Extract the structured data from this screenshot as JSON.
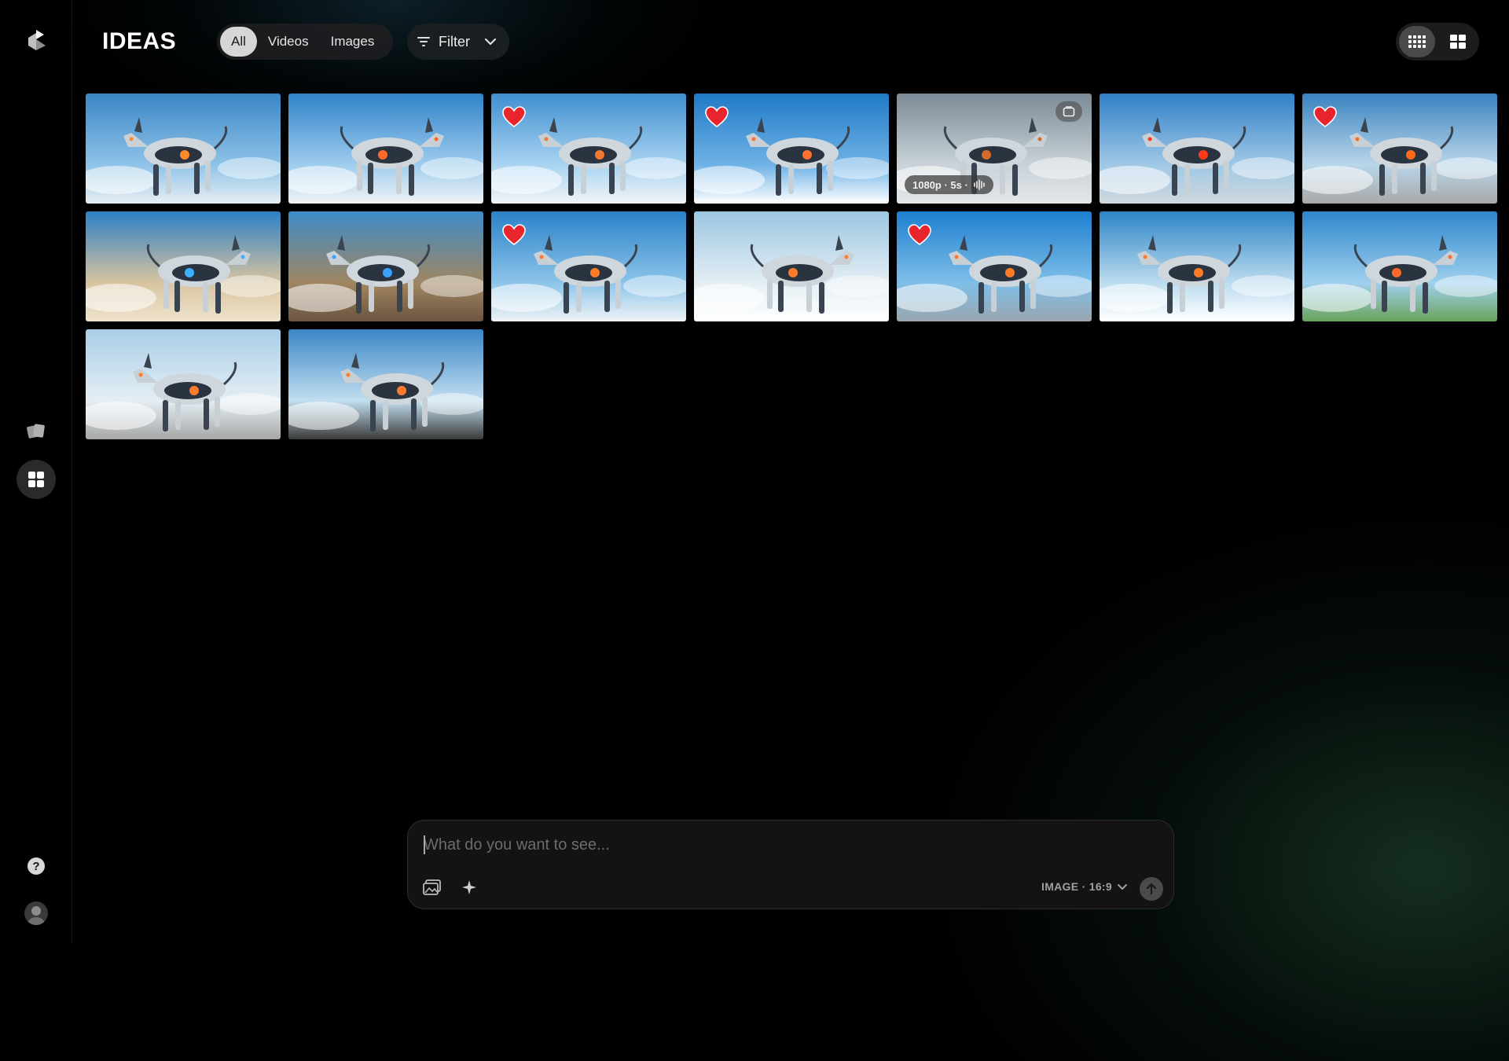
{
  "app": {
    "brand": "IDEAS"
  },
  "sidebar": {
    "items": [
      {
        "name": "cards",
        "icon": "cards-icon"
      },
      {
        "name": "ideas",
        "icon": "grid-icon",
        "active": true
      },
      {
        "name": "help",
        "icon": "help-icon"
      },
      {
        "name": "profile",
        "icon": "avatar"
      }
    ]
  },
  "tabs": [
    {
      "label": "All",
      "active": true
    },
    {
      "label": "Videos",
      "active": false
    },
    {
      "label": "Images",
      "active": false
    }
  ],
  "filter": {
    "label": "Filter"
  },
  "view_toggle": {
    "active": "compact-grid"
  },
  "gallery": {
    "tiles": [
      {
        "liked": false,
        "palette": [
          "#3a86c6",
          "#8fc3e8",
          "#e8eef3"
        ],
        "accent": "#ff8a2a"
      },
      {
        "liked": false,
        "palette": [
          "#2f82c9",
          "#9fcdee",
          "#f0f3f5"
        ],
        "accent": "#ff6a2a"
      },
      {
        "liked": true,
        "palette": [
          "#3f8fd0",
          "#a9d4f2",
          "#f2f4f6"
        ],
        "accent": "#f07a30"
      },
      {
        "liked": true,
        "palette": [
          "#1f7ac6",
          "#6fb2e6",
          "#ffffff"
        ],
        "accent": "#ff7030"
      },
      {
        "liked": false,
        "palette": [
          "#7a8a96",
          "#c9d2d8",
          "#e4e7ea"
        ],
        "accent": "#d86a2a",
        "video": true,
        "badge": "1080p · 5s ·"
      },
      {
        "liked": false,
        "palette": [
          "#2f7fc8",
          "#a0c8e6",
          "#cfd8de"
        ],
        "accent": "#ff3a1a"
      },
      {
        "liked": true,
        "palette": [
          "#3a82c0",
          "#b9d6ea",
          "#a8a8a8"
        ],
        "accent": "#ff6a1a"
      },
      {
        "liked": false,
        "palette": [
          "#2d7fc4",
          "#d8c4a0",
          "#efe3cc"
        ],
        "accent": "#3ab0ff"
      },
      {
        "liked": false,
        "palette": [
          "#3d8cc8",
          "#a08662",
          "#6c5440"
        ],
        "accent": "#3aa0ff"
      },
      {
        "liked": true,
        "palette": [
          "#2a82c8",
          "#8cc4ea",
          "#f0f3f5"
        ],
        "accent": "#ff7a2a"
      },
      {
        "liked": false,
        "palette": [
          "#9cc6e2",
          "#e4eef4",
          "#ffffff"
        ],
        "accent": "#ff7a2a"
      },
      {
        "liked": true,
        "palette": [
          "#1d7fd0",
          "#7fbfe8",
          "#9aa6b0"
        ],
        "accent": "#ff7a2a"
      },
      {
        "liked": false,
        "palette": [
          "#2c84c6",
          "#bcdcef",
          "#ffffff"
        ],
        "accent": "#ff7a2a"
      },
      {
        "liked": false,
        "palette": [
          "#2e86cc",
          "#9fd0ee",
          "#6aa35a"
        ],
        "accent": "#ff6a2a"
      },
      {
        "liked": false,
        "palette": [
          "#a9cde6",
          "#e4eef4",
          "#a7a7a7"
        ],
        "accent": "#ff7a2a"
      },
      {
        "liked": false,
        "palette": [
          "#3a86c6",
          "#c2def0",
          "#3a3a3a"
        ],
        "accent": "#ff7a2a"
      }
    ]
  },
  "prompt": {
    "placeholder": "What do you want to see...",
    "mode_label": "IMAGE · 16:9"
  },
  "colors": {
    "heart": "#e8242c",
    "active_pill": "#d6d6d6"
  }
}
